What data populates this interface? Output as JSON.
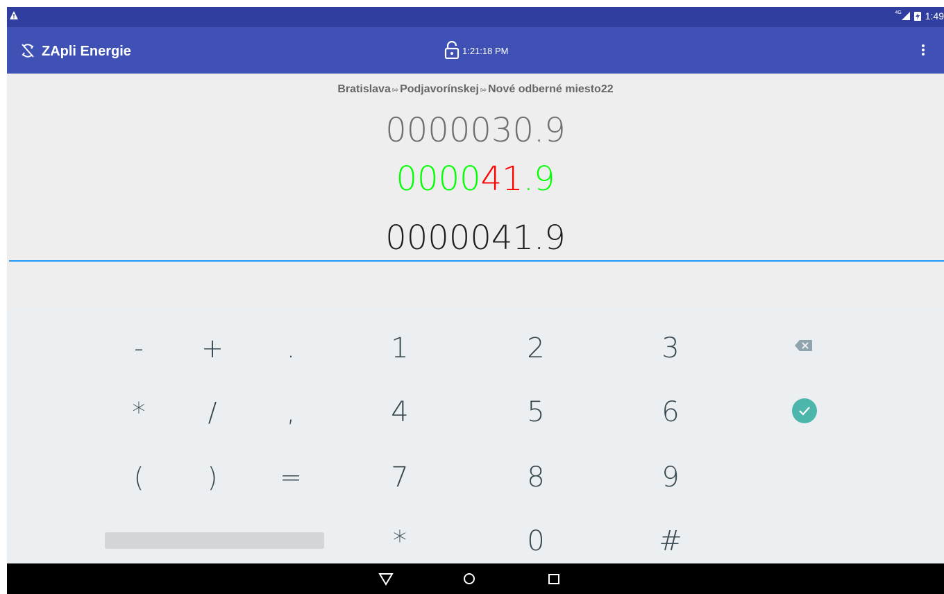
{
  "status_bar": {
    "network": "4G",
    "clock": "1:49"
  },
  "app_bar": {
    "title": "ZApli Energie",
    "time": "1:21:18 PM"
  },
  "location": {
    "parts": [
      "Bratislava",
      "Podjavorínskej",
      "Nové odberné miesto22"
    ],
    "separator": "⇰"
  },
  "readings": {
    "previous": "0000030.9",
    "current_prefix": "0000",
    "current_changed": "41",
    "current_suffix": ".9",
    "input_value": "0000041.9"
  },
  "colors": {
    "status_bar": "#303f9f",
    "app_bar": "#3f51b5",
    "current_unchanged": "#00ff00",
    "current_changed": "#ff0000",
    "input_underline": "#2196f3",
    "done_button": "#4db6ac"
  },
  "keypad": {
    "symbols_row1": [
      "-",
      "+",
      "."
    ],
    "symbols_row2": [
      "*",
      "/",
      ","
    ],
    "symbols_row3": [
      "(",
      ")",
      "="
    ],
    "digits_row1": [
      "1",
      "2",
      "3"
    ],
    "digits_row2": [
      "4",
      "5",
      "6"
    ],
    "digits_row3": [
      "7",
      "8",
      "9"
    ],
    "digits_row4": [
      "*",
      "0",
      "#"
    ]
  }
}
